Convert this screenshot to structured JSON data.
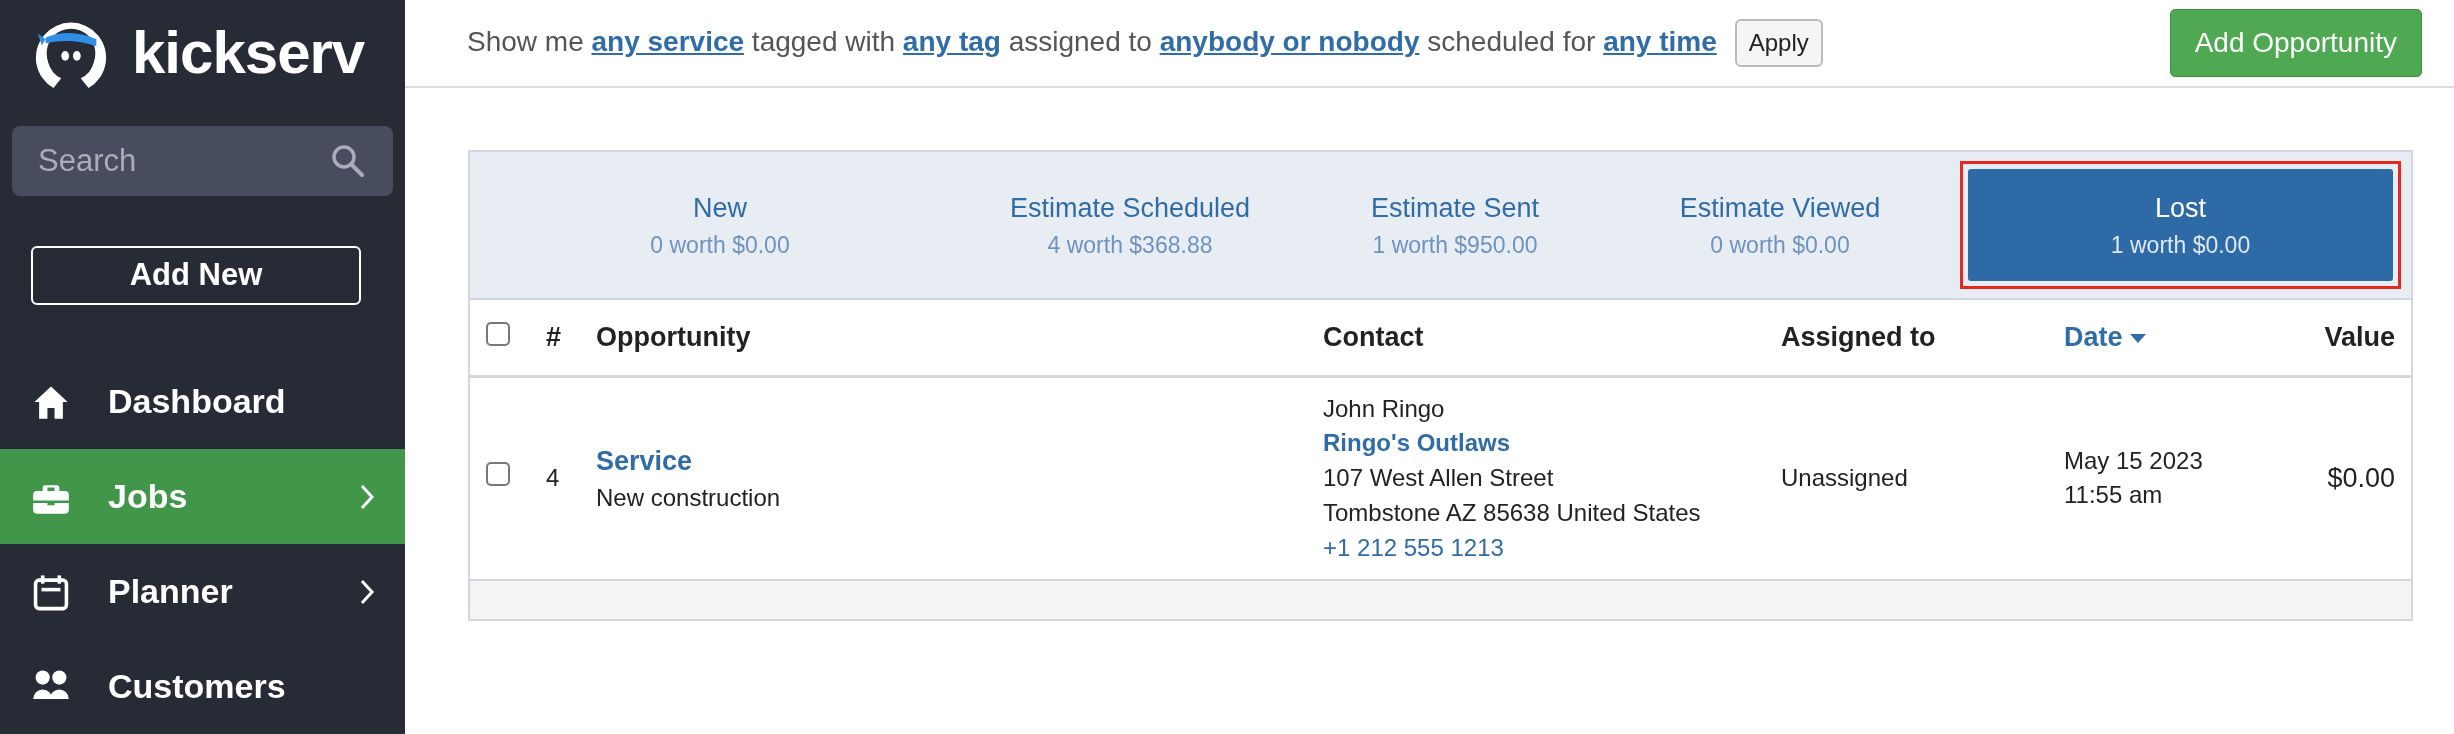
{
  "sidebar": {
    "logo": "kickserv",
    "search": {
      "placeholder": "Search"
    },
    "add_button": "Add New",
    "items": [
      {
        "label": "Dashboard",
        "selected": false,
        "expandable": false
      },
      {
        "label": "Jobs",
        "selected": true,
        "expandable": true
      },
      {
        "label": "Planner",
        "selected": false,
        "expandable": true
      },
      {
        "label": "Customers",
        "selected": false,
        "expandable": false
      }
    ]
  },
  "filter": {
    "parts": [
      {
        "kind": "text",
        "text": "Show me"
      },
      {
        "kind": "link",
        "text": "any service"
      },
      {
        "kind": "text",
        "text": "tagged with"
      },
      {
        "kind": "link",
        "text": "any tag"
      },
      {
        "kind": "text",
        "text": "assigned to"
      },
      {
        "kind": "link",
        "text": "anybody or nobody"
      },
      {
        "kind": "text",
        "text": "scheduled for"
      },
      {
        "kind": "link",
        "text": "any time"
      }
    ],
    "apply": "Apply"
  },
  "add_opportunity": "Add Opportunity",
  "stages": [
    {
      "name": "New",
      "summary": "0 worth $0.00",
      "selected": false,
      "highlighted": false
    },
    {
      "name": "Estimate Scheduled",
      "summary": "4 worth $368.88",
      "selected": false,
      "highlighted": false
    },
    {
      "name": "Estimate Sent",
      "summary": "1 worth $950.00",
      "selected": false,
      "highlighted": false
    },
    {
      "name": "Estimate Viewed",
      "summary": "0 worth $0.00",
      "selected": false,
      "highlighted": false
    },
    {
      "name": "Lost",
      "summary": "1 worth $0.00",
      "selected": true,
      "highlighted": true
    }
  ],
  "table": {
    "columns": [
      {
        "kind": "select",
        "checked": false
      },
      {
        "kind": "text",
        "label": "#"
      },
      {
        "kind": "text",
        "label": "Opportunity"
      },
      {
        "kind": "text",
        "label": "Contact"
      },
      {
        "kind": "text",
        "label": "Assigned to"
      },
      {
        "kind": "sort",
        "label": "Date",
        "sorted": true
      },
      {
        "kind": "value",
        "label": "Value"
      }
    ],
    "rows": [
      {
        "checked": false,
        "number": "4",
        "title": "Service",
        "description": "New construction",
        "contact": {
          "name": "John Ringo",
          "company": "Ringo's Outlaws",
          "address_1": "107 West Allen Street",
          "address_2": "Tombstone AZ 85638 United States",
          "phone": "+1 212 555 1213"
        },
        "assigned_to": "Unassigned",
        "date": "May 15 2023",
        "time": "11:55 am",
        "value": "$0.00"
      }
    ]
  }
}
